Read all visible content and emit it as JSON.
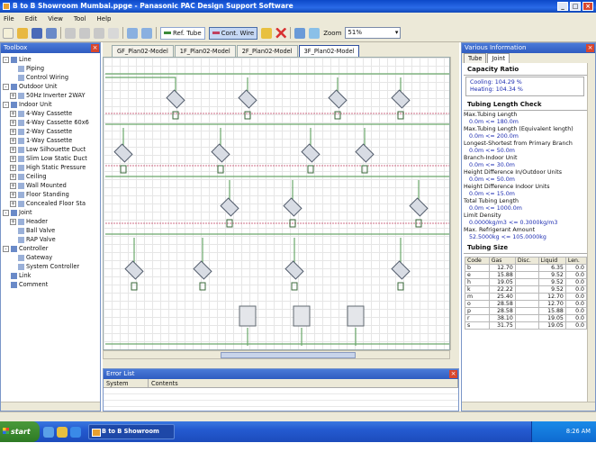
{
  "window": {
    "title": "B to B Showroom Mumbai.ppge - Panasonic PAC Design Support Software",
    "buttons": [
      "_",
      "□",
      "×"
    ]
  },
  "menu": [
    "File",
    "Edit",
    "View",
    "Tool",
    "Help"
  ],
  "toolbar": {
    "ref_tube": "Ref. Tube",
    "cont_wire": "Cont. Wire",
    "zoom_label": "Zoom",
    "zoom_value": "51%"
  },
  "toolbox": {
    "title": "Toolbox",
    "items": [
      {
        "label": "Line",
        "level": 0,
        "exp": "-"
      },
      {
        "label": "Piping",
        "level": 1,
        "exp": ""
      },
      {
        "label": "Control Wiring",
        "level": 1,
        "exp": ""
      },
      {
        "label": "Outdoor Unit",
        "level": 0,
        "exp": "-"
      },
      {
        "label": "50Hz Inverter 2WAY",
        "level": 1,
        "exp": "+"
      },
      {
        "label": "Indoor Unit",
        "level": 0,
        "exp": "-"
      },
      {
        "label": "4-Way Cassette",
        "level": 1,
        "exp": "+"
      },
      {
        "label": "4-Way Cassette 60x6",
        "level": 1,
        "exp": "+"
      },
      {
        "label": "2-Way Cassette",
        "level": 1,
        "exp": "+"
      },
      {
        "label": "1-Way Cassette",
        "level": 1,
        "exp": "+"
      },
      {
        "label": "Low Silhouette Duct",
        "level": 1,
        "exp": "+"
      },
      {
        "label": "Slim Low Static Duct",
        "level": 1,
        "exp": "+"
      },
      {
        "label": "High Static Pressure",
        "level": 1,
        "exp": "+"
      },
      {
        "label": "Ceiling",
        "level": 1,
        "exp": "+"
      },
      {
        "label": "Wall Mounted",
        "level": 1,
        "exp": "+"
      },
      {
        "label": "Floor Standing",
        "level": 1,
        "exp": "+"
      },
      {
        "label": "Concealed Floor Sta",
        "level": 1,
        "exp": "+"
      },
      {
        "label": "Joint",
        "level": 0,
        "exp": "-"
      },
      {
        "label": "Header",
        "level": 1,
        "exp": "+"
      },
      {
        "label": "Ball Valve",
        "level": 1,
        "exp": ""
      },
      {
        "label": "RAP Valve",
        "level": 1,
        "exp": ""
      },
      {
        "label": "Controller",
        "level": 0,
        "exp": "-"
      },
      {
        "label": "Gateway",
        "level": 1,
        "exp": ""
      },
      {
        "label": "System Controller",
        "level": 1,
        "exp": ""
      },
      {
        "label": "Link",
        "level": 0,
        "exp": ""
      },
      {
        "label": "Comment",
        "level": 0,
        "exp": ""
      }
    ]
  },
  "tabs": [
    "GF_Plan02-Model",
    "1F_Plan02-Model",
    "2F_Plan02-Model",
    "3F_Plan02-Model"
  ],
  "active_tab": "3F_Plan02-Model",
  "error_list": {
    "title": "Error List",
    "columns": [
      "System",
      "Contents"
    ]
  },
  "various": {
    "title": "Various Information",
    "tabs": [
      "Tube",
      "Joint"
    ],
    "capacity_title": "Capacity Ratio",
    "cooling": "Cooling: 104.29 %",
    "heating": "Heating: 104.34 %",
    "tubing_check_title": "Tubing Length Check",
    "checks": [
      {
        "label": "Max.Tubing Length",
        "value": "0.0m      <=   180.0m"
      },
      {
        "label": "Max.Tubing Length (Equivalent length)",
        "value": "0.0m      <=   200.0m"
      },
      {
        "label": "Longest-Shortest from Primary Branch",
        "value": "0.0m      <=   50.0m"
      },
      {
        "label": "Branch-Indoor Unit",
        "value": "0.0m      <=   30.0m"
      },
      {
        "label": "Height Difference In/Outdoor Units",
        "value": "0.0m      <=   50.0m"
      },
      {
        "label": "Height Difference Indoor Units",
        "value": "0.0m      <=   15.0m"
      },
      {
        "label": "Total Tubing Length",
        "value": "0.0m      <=   1000.0m"
      },
      {
        "label": "Limit Density",
        "value": "0.0000kg/m3 <=   0.3000kg/m3"
      },
      {
        "label": "Max. Refrigerant Amount",
        "value": "52.5000kg   <=   105.0000kg"
      }
    ],
    "tubing_size_title": "Tubing Size",
    "table_headers": [
      "Code",
      "Gas",
      "Disc.",
      "Liquid",
      "Len."
    ],
    "table_rows": [
      [
        "b",
        "12.70",
        "",
        "6.35",
        "0.0"
      ],
      [
        "e",
        "15.88",
        "",
        "9.52",
        "0.0"
      ],
      [
        "h",
        "19.05",
        "",
        "9.52",
        "0.0"
      ],
      [
        "k",
        "22.22",
        "",
        "9.52",
        "0.0"
      ],
      [
        "m",
        "25.40",
        "",
        "12.70",
        "0.0"
      ],
      [
        "o",
        "28.58",
        "",
        "12.70",
        "0.0"
      ],
      [
        "p",
        "28.58",
        "",
        "15.88",
        "0.0"
      ],
      [
        "r",
        "38.10",
        "",
        "19.05",
        "0.0"
      ],
      [
        "s",
        "31.75",
        "",
        "19.05",
        "0.0"
      ]
    ]
  },
  "taskbar": {
    "start": "start",
    "task": "B to B Showroom Mu...",
    "clock": "8:26 AM"
  },
  "colors": {
    "title_bar": "#1048b8",
    "pipe": "#6aa86a",
    "wire": "#c04060",
    "unit_label": "#3040a0"
  }
}
